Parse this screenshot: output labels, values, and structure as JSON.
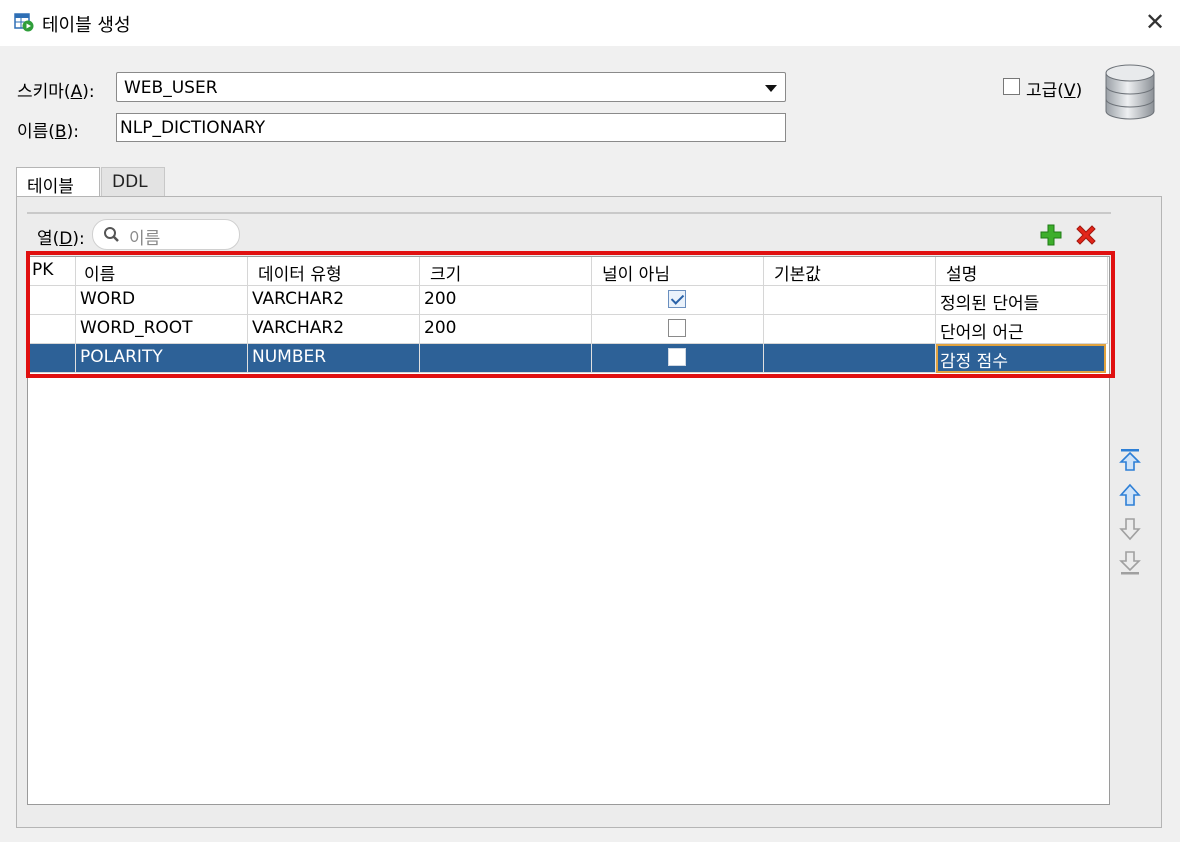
{
  "window": {
    "title": "테이블 생성",
    "close_glyph": "✕"
  },
  "schema": {
    "label_prefix": "스키마(",
    "label_key": "A",
    "label_suffix": "):",
    "value": "WEB_USER"
  },
  "name": {
    "label_prefix": "이름(",
    "label_key": "B",
    "label_suffix": "):",
    "value": "NLP_DICTIONARY"
  },
  "advanced": {
    "label_prefix": "고급(",
    "label_key": "V",
    "label_suffix": ")",
    "checked": false
  },
  "tabs": [
    {
      "label": "테이블",
      "active": true
    },
    {
      "label": "DDL",
      "active": false
    }
  ],
  "columns_panel": {
    "label_prefix": "열(",
    "label_key": "D",
    "label_suffix": "):",
    "search_placeholder": "이름"
  },
  "grid": {
    "headers": [
      "PK",
      "이름",
      "데이터 유형",
      "크기",
      "널이 아님",
      "기본값",
      "설명"
    ],
    "rows": [
      {
        "pk": "",
        "name": "WORD",
        "type": "VARCHAR2",
        "size": "200",
        "not_null": true,
        "default": "",
        "desc": "정의된 단어들",
        "selected": false
      },
      {
        "pk": "",
        "name": "WORD_ROOT",
        "type": "VARCHAR2",
        "size": "200",
        "not_null": false,
        "default": "",
        "desc": "단어의 어근",
        "selected": false
      },
      {
        "pk": "",
        "name": "POLARITY",
        "type": "NUMBER",
        "size": "",
        "not_null": false,
        "default": "",
        "desc": "감정 점수",
        "selected": true
      }
    ]
  },
  "colors": {
    "selection": "#2d6197",
    "highlight_border": "#e01010",
    "edit_border": "#e1a340"
  }
}
